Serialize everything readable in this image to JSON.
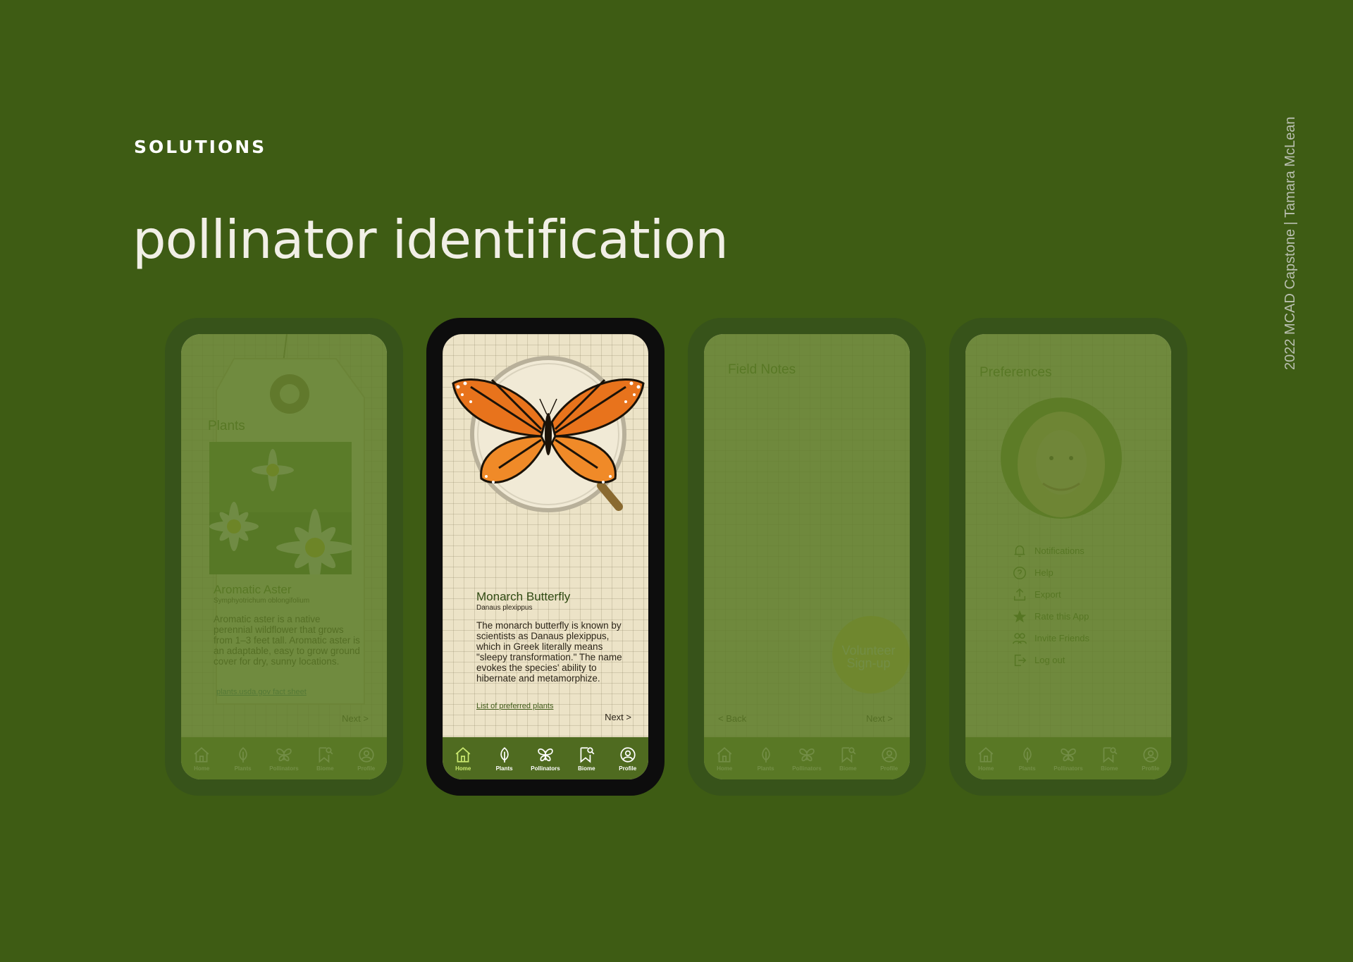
{
  "slide": {
    "eyebrow": "SOLUTIONS",
    "headline": "pollinator identification",
    "credit": "2022 MCAD Capstone | Tamara McLean"
  },
  "nav": {
    "home": "Home",
    "plants": "Plants",
    "pollinators": "Pollinators",
    "biome": "Biome",
    "profile": "Profile"
  },
  "plants_screen": {
    "title": "Plants",
    "name": "Aromatic Aster",
    "latin": "Symphyotrichum oblongifolium",
    "body": "Aromatic aster is a native perennial wildflower that grows from 1–3 feet tall. Aromatic aster is an adaptable, easy to grow ground cover for dry, sunny locations.",
    "link": "plants.usda.gov fact sheet",
    "next": "Next >"
  },
  "butterfly_screen": {
    "name": "Monarch Butterfly",
    "latin": "Danaus plexippus",
    "body": "The monarch butterfly is known by scientists as Danaus plexippus, which in Greek literally means \"sleepy transformation.\" The name evokes the species' ability to hibernate and metamorphize.",
    "link": "List of preferred plants",
    "next": "Next >"
  },
  "field_notes_screen": {
    "title": "Field Notes",
    "cta": "Volunteer Sign-up",
    "back": "< Back",
    "next": "Next >"
  },
  "preferences_screen": {
    "title": "Preferences",
    "items": [
      {
        "label": "Notifications",
        "icon": "bell-icon"
      },
      {
        "label": "Help",
        "icon": "help-icon"
      },
      {
        "label": "Export",
        "icon": "export-icon"
      },
      {
        "label": "Rate this App",
        "icon": "star-icon"
      },
      {
        "label": "Invite Friends",
        "icon": "users-icon"
      },
      {
        "label": "Log out",
        "icon": "logout-icon"
      }
    ]
  },
  "colors": {
    "background": "#3e5c14",
    "nav_bar": "#4f6b20",
    "active_nav": "#c9e86f",
    "monarch_orange": "#e8731c"
  }
}
